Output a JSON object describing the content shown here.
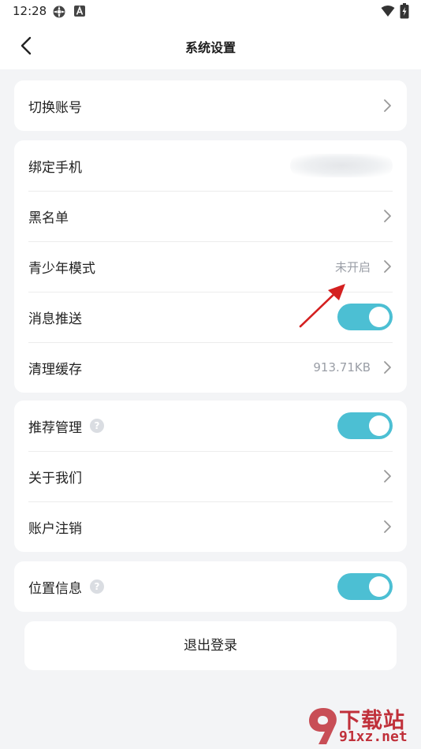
{
  "status_bar": {
    "time": "12:28",
    "icons": [
      "location-sync-icon",
      "a-badge-icon",
      "wifi-icon",
      "battery-charging-icon"
    ]
  },
  "nav": {
    "title": "系统设置",
    "back_icon": "chevron-left-icon"
  },
  "groups": [
    {
      "items": [
        {
          "label": "切换账号",
          "control": "chevron"
        }
      ]
    },
    {
      "items": [
        {
          "label": "绑定手机",
          "control": "blurred-value"
        },
        {
          "label": "黑名单",
          "control": "chevron"
        },
        {
          "label": "青少年模式",
          "value": "未开启",
          "control": "chevron"
        },
        {
          "label": "消息推送",
          "control": "toggle",
          "on": true
        },
        {
          "label": "清理缓存",
          "value": "913.71KB",
          "control": "chevron"
        }
      ]
    },
    {
      "items": [
        {
          "label": "推荐管理",
          "control": "toggle",
          "on": true,
          "help": "?"
        },
        {
          "label": "关于我们",
          "control": "chevron"
        },
        {
          "label": "账户注销",
          "control": "chevron"
        }
      ]
    },
    {
      "items": [
        {
          "label": "位置信息",
          "control": "toggle",
          "on": true,
          "help": "?"
        }
      ]
    }
  ],
  "logout": {
    "label": "退出登录"
  },
  "watermark": {
    "line1": "下载站",
    "line2": "91xz.net"
  },
  "colors": {
    "toggle_on": "#4cbfd3",
    "background": "#f3f4f6",
    "annotation_arrow": "#d42020",
    "watermark": "#c0303a"
  }
}
